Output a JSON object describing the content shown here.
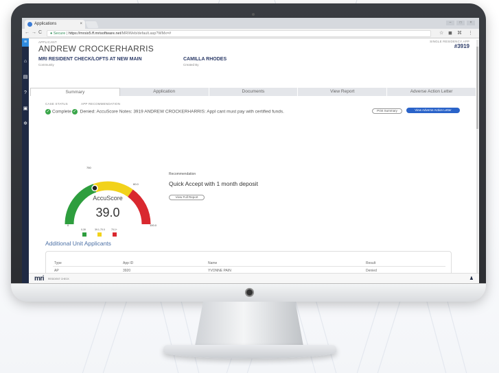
{
  "browser": {
    "tab_title": "Applications",
    "tab_close": "×",
    "secure_label": "Secure",
    "url_host": "https://mrsix5.ff.mrisoftware.net",
    "url_path": "/MRIWeb/default.asp?WMx=#",
    "nav_back": "←",
    "nav_forward": "→",
    "nav_reload": "C",
    "toolbar_icons": [
      "star-icon",
      "extension-icon",
      "cast-icon",
      "menu-icon"
    ]
  },
  "sidebar": {
    "icons": [
      "hamburger-icon",
      "home-icon",
      "document-icon",
      "help-icon",
      "tablet-icon",
      "settings-icon"
    ]
  },
  "header": {
    "applicant_label": "APPLICANT",
    "applicant_name": "ANDREW CROCKERHARRIS",
    "property_name": "MRI RESIDENT CHECK/LOFTS AT NEW MAIN",
    "property_sub": "Community",
    "creator_name": "CAMILLA RHODES",
    "creator_sub": "Created By",
    "id_label": "SINGLE RESIDENCY APP",
    "id_number": "#3919"
  },
  "tabs": [
    "Summary",
    "Application",
    "Documents",
    "View Report",
    "Adverse Action Letter"
  ],
  "status": {
    "col1_label": "CASE STATUS",
    "col2_label": "APP RECOMMENDATION",
    "status_value": "Complete",
    "message": "Denied: AccuScore Notes: 3919 ANDREW CROCKERHARRIS: Appl cant must pay with certified funds."
  },
  "buttons": {
    "print_summary": "Print Summary",
    "view_adverse": "View Adverse Action Letter",
    "view_full_report": "View Full Report"
  },
  "gauge": {
    "title": "AccuScore",
    "score": "39.0",
    "score_value": 39.0,
    "min_label": "0",
    "mark_top": "750",
    "mark_right": "60.0",
    "max_label": "100.0",
    "legend": [
      {
        "label": "0-39",
        "color": "#2e9e3e"
      },
      {
        "label": "39.1-70.0",
        "color": "#f2d21b"
      },
      {
        "label": "70.1+",
        "color": "#d9282f"
      }
    ],
    "colors": {
      "green": "#2e9e3e",
      "yellow": "#f2d21b",
      "red": "#d9282f"
    }
  },
  "recommendation": {
    "label": "Recommendation",
    "text": "Quick Accept with 1 month deposit"
  },
  "additional": {
    "title": "Additional Unit Applicants",
    "columns": [
      "Type",
      "App ID",
      "Name",
      "Result"
    ],
    "rows": [
      {
        "type": "AP",
        "app_id": "3920",
        "name": "YVONNE PAIN",
        "result": "Denied"
      }
    ]
  },
  "footer": {
    "logo": "mri",
    "logo_sub": "RESIDENT CHECK"
  }
}
